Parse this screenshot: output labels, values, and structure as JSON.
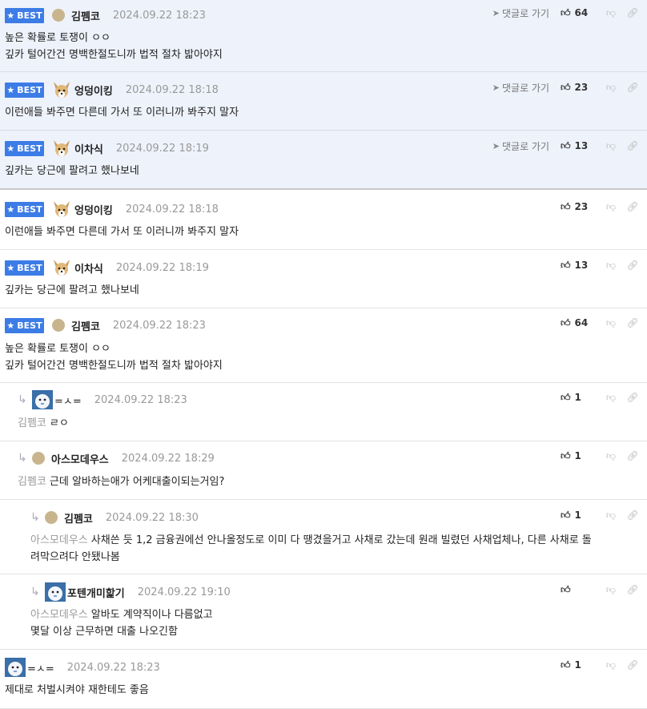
{
  "best_label": "BEST",
  "goto_label": "댓글로 가기",
  "comments": [
    {
      "nick": "김펨코",
      "date": "2024.09.22 18:23",
      "likes": "64",
      "lines": "높은 확률로 토쟁이 ㅇㅇ\n깊카 털어간건 명백한절도니까 법적 절차 밟아야지"
    },
    {
      "nick": "엉덩이킹",
      "date": "2024.09.22 18:18",
      "likes": "23",
      "lines": "이런애들 봐주면 다른데 가서 또 이러니까 봐주지 말자"
    },
    {
      "nick": "이차식",
      "date": "2024.09.22 18:19",
      "likes": "13",
      "lines": "깊카는 당근에 팔려고 했나보네"
    },
    {
      "nick": "엉덩이킹",
      "date": "2024.09.22 18:18",
      "likes": "23",
      "lines": "이런애들 봐주면 다른데 가서 또 이러니까 봐주지 말자"
    },
    {
      "nick": "이차식",
      "date": "2024.09.22 18:19",
      "likes": "13",
      "lines": "깊카는 당근에 팔려고 했나보네"
    },
    {
      "nick": "김펨코",
      "date": "2024.09.22 18:23",
      "likes": "64",
      "lines": "높은 확률로 토쟁이 ㅇㅇ\n깊카 털어간건 명백한절도니까 법적 절차 밟아야지"
    },
    {
      "nick": "=ㅅ=",
      "date": "2024.09.22 18:23",
      "likes": "1",
      "mention": "김펨코",
      "text": "ㄹㅇ"
    },
    {
      "nick": "아스모데우스",
      "date": "2024.09.22 18:29",
      "likes": "1",
      "mention": "김펨코",
      "text": "근데 알바하는애가 어케대출이되는거임?"
    },
    {
      "nick": "김펨코",
      "date": "2024.09.22 18:30",
      "likes": "1",
      "mention": "아스모데우스",
      "text": "사채쓴 듯 1,2 금융권에선 안나올정도로 이미 다 땡겼을거고 사채로 갔는데 원래 빌렸던 사채업체나, 다른 사채로 돌\n려막으려다 안됐나봄"
    },
    {
      "nick": "포텐개미핥기",
      "date": "2024.09.22 19:10",
      "likes": "",
      "mention": "아스모데우스",
      "text": "알바도 계약직이나 다름없고\n몇달 이상 근무하면 대출 나오긴함"
    },
    {
      "nick": "=ㅅ=",
      "date": "2024.09.22 18:23",
      "likes": "1",
      "lines": "제대로 처벌시켜야 재한테도 좋음"
    }
  ]
}
